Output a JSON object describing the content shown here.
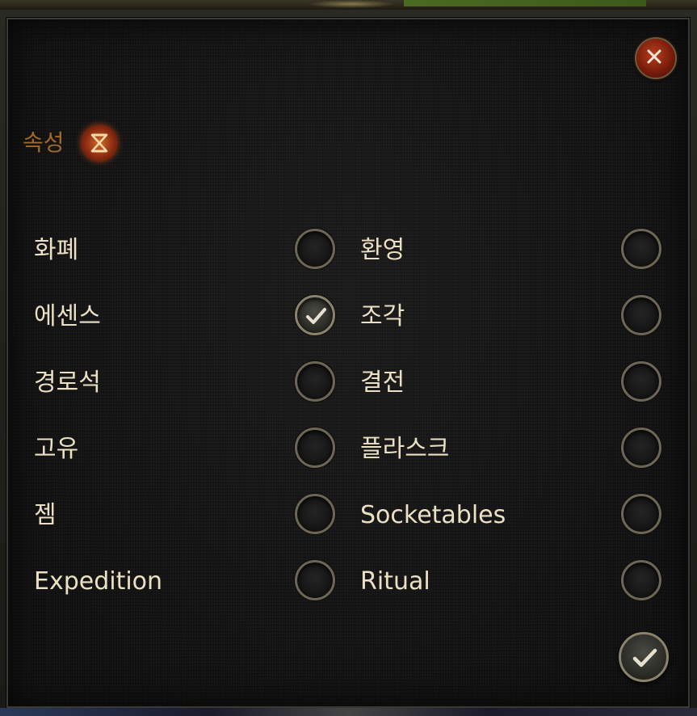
{
  "dialog": {
    "header_label": "속성",
    "header_icon": "hourglass-icon",
    "close_icon": "close-icon",
    "confirm_icon": "checkmark-icon"
  },
  "options": [
    {
      "left": {
        "label": "화폐",
        "checked": false
      },
      "right": {
        "label": "환영",
        "checked": false
      }
    },
    {
      "left": {
        "label": "에센스",
        "checked": true
      },
      "right": {
        "label": "조각",
        "checked": false
      }
    },
    {
      "left": {
        "label": "경로석",
        "checked": false
      },
      "right": {
        "label": "결전",
        "checked": false
      }
    },
    {
      "left": {
        "label": "고유",
        "checked": false
      },
      "right": {
        "label": "플라스크",
        "checked": false
      }
    },
    {
      "left": {
        "label": "젬",
        "checked": false
      },
      "right": {
        "label": "Socketables",
        "checked": false
      }
    },
    {
      "left": {
        "label": "Expedition",
        "checked": false
      },
      "right": {
        "label": "Ritual",
        "checked": false
      }
    }
  ],
  "colors": {
    "header_text": "#a0682a",
    "option_text": "#ece0c4",
    "close_button": "#9a2e14"
  }
}
